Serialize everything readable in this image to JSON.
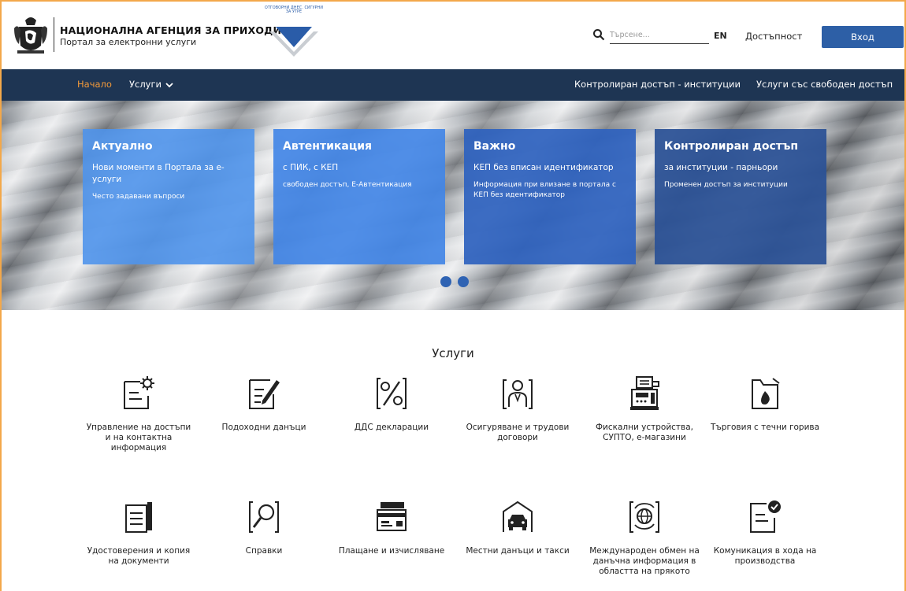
{
  "header": {
    "agency_name": "НАЦИОНАЛНА АГЕНЦИЯ ЗА ПРИХОДИТЕ",
    "portal_subtitle": "Портал за електронни услуги",
    "emblem_text": "ОТГОВОРНИ ДНЕС. СИГУРНИ ЗА УТРЕ",
    "search_placeholder": "Търсене...",
    "lang_label": "EN",
    "accessibility_label": "Достъпност",
    "login_label": "Вход"
  },
  "nav": {
    "home": "Начало",
    "services": "Услуги",
    "controlled_access": "Контролиран достъп - институции",
    "free_access": "Услуги със свободен достъп"
  },
  "hero": {
    "cards": [
      {
        "title": "Актуално",
        "line1": "Нови моменти в Портала за е-услуги",
        "line2": "Често задавани въпроси"
      },
      {
        "title": "Автентикация",
        "line1": "с ПИК, с КЕП",
        "line2": "свободен достъп, Е-Автентикация"
      },
      {
        "title": "Важно",
        "line1": "КЕП без вписан идентификатор",
        "line2": "Информация при влизане в портала с КЕП без идентификатор"
      },
      {
        "title": "Контролиран достъп",
        "line1": "за институции - парньори",
        "line2": "Променен достъп за институции"
      }
    ],
    "slide_count": 2
  },
  "services": {
    "title": "Услуги",
    "items": [
      {
        "label": "Управление на достъпи и на контактна информация",
        "icon": "document-gear-icon"
      },
      {
        "label": "Подоходни данъци",
        "icon": "document-pen-icon"
      },
      {
        "label": "ДДС декларации",
        "icon": "percent-icon"
      },
      {
        "label": "Осигуряване и трудови договори",
        "icon": "person-icon"
      },
      {
        "label": "Фискални устройства, СУПТО, е-магазини",
        "icon": "cash-register-icon"
      },
      {
        "label": "Търговия с течни горива",
        "icon": "fuel-can-icon"
      },
      {
        "label": "Удостоверения и копия на документи",
        "icon": "document-copies-icon"
      },
      {
        "label": "Справки",
        "icon": "magnifier-icon"
      },
      {
        "label": "Плащане и изчисляване",
        "icon": "payment-card-icon"
      },
      {
        "label": "Местни данъци и такси",
        "icon": "house-car-icon"
      },
      {
        "label": "Международен обмен на данъчна информация в областта на прякото",
        "icon": "globe-exchange-icon"
      },
      {
        "label": "Комуникация в хода на производства",
        "icon": "document-check-icon"
      }
    ]
  },
  "colors": {
    "nav_bg": "#1e3553",
    "accent": "#f39a3a",
    "primary": "#2d5fa6"
  }
}
